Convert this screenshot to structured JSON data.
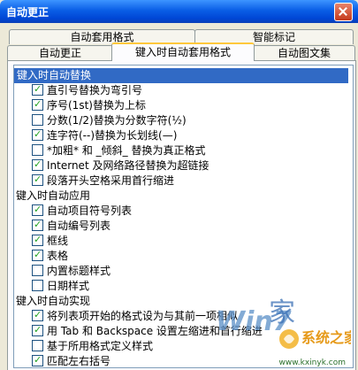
{
  "window": {
    "title": "自动更正"
  },
  "tabs": {
    "row1": [
      "自动套用格式",
      "智能标记"
    ],
    "row2": [
      "自动更正",
      "键入时自动套用格式",
      "自动图文集"
    ],
    "active": "键入时自动套用格式"
  },
  "options": {
    "group1": "键入时自动替换",
    "items1": [
      {
        "label": "直引号替换为弯引号",
        "checked": true
      },
      {
        "label": "序号(1st)替换为上标",
        "checked": true
      },
      {
        "label": "分数(1/2)替换为分数字符(½)",
        "checked": false
      },
      {
        "label": "连字符(--)替换为长划线(—)",
        "checked": true
      },
      {
        "label": "*加粗* 和 _倾斜_ 替换为真正格式",
        "checked": false
      },
      {
        "label": "Internet 及网络路径替换为超链接",
        "checked": true
      },
      {
        "label": "段落开头空格采用首行缩进",
        "checked": true
      }
    ],
    "group2": "键入时自动应用",
    "items2": [
      {
        "label": "自动项目符号列表",
        "checked": true
      },
      {
        "label": "自动编号列表",
        "checked": true
      },
      {
        "label": "框线",
        "checked": true
      },
      {
        "label": "表格",
        "checked": true
      },
      {
        "label": "内置标题样式",
        "checked": false
      },
      {
        "label": "日期样式",
        "checked": false
      }
    ],
    "group3": "键入时自动实现",
    "items3": [
      {
        "label": "将列表项开始的格式设为与其前一项相似",
        "checked": true
      },
      {
        "label": "用 Tab 和 Backspace 设置左缩进和首行缩进",
        "checked": true
      },
      {
        "label": "基于所用格式定义样式",
        "checked": false
      },
      {
        "label": "匹配左右括号",
        "checked": true
      }
    ]
  },
  "watermark": {
    "text1": "Win7",
    "text2": "家",
    "logo": "系统之家",
    "url": "www.kxinyk.com"
  },
  "colors": {
    "title": "#0a5ee6",
    "selection": "#316ac5",
    "check": "#21a121"
  }
}
